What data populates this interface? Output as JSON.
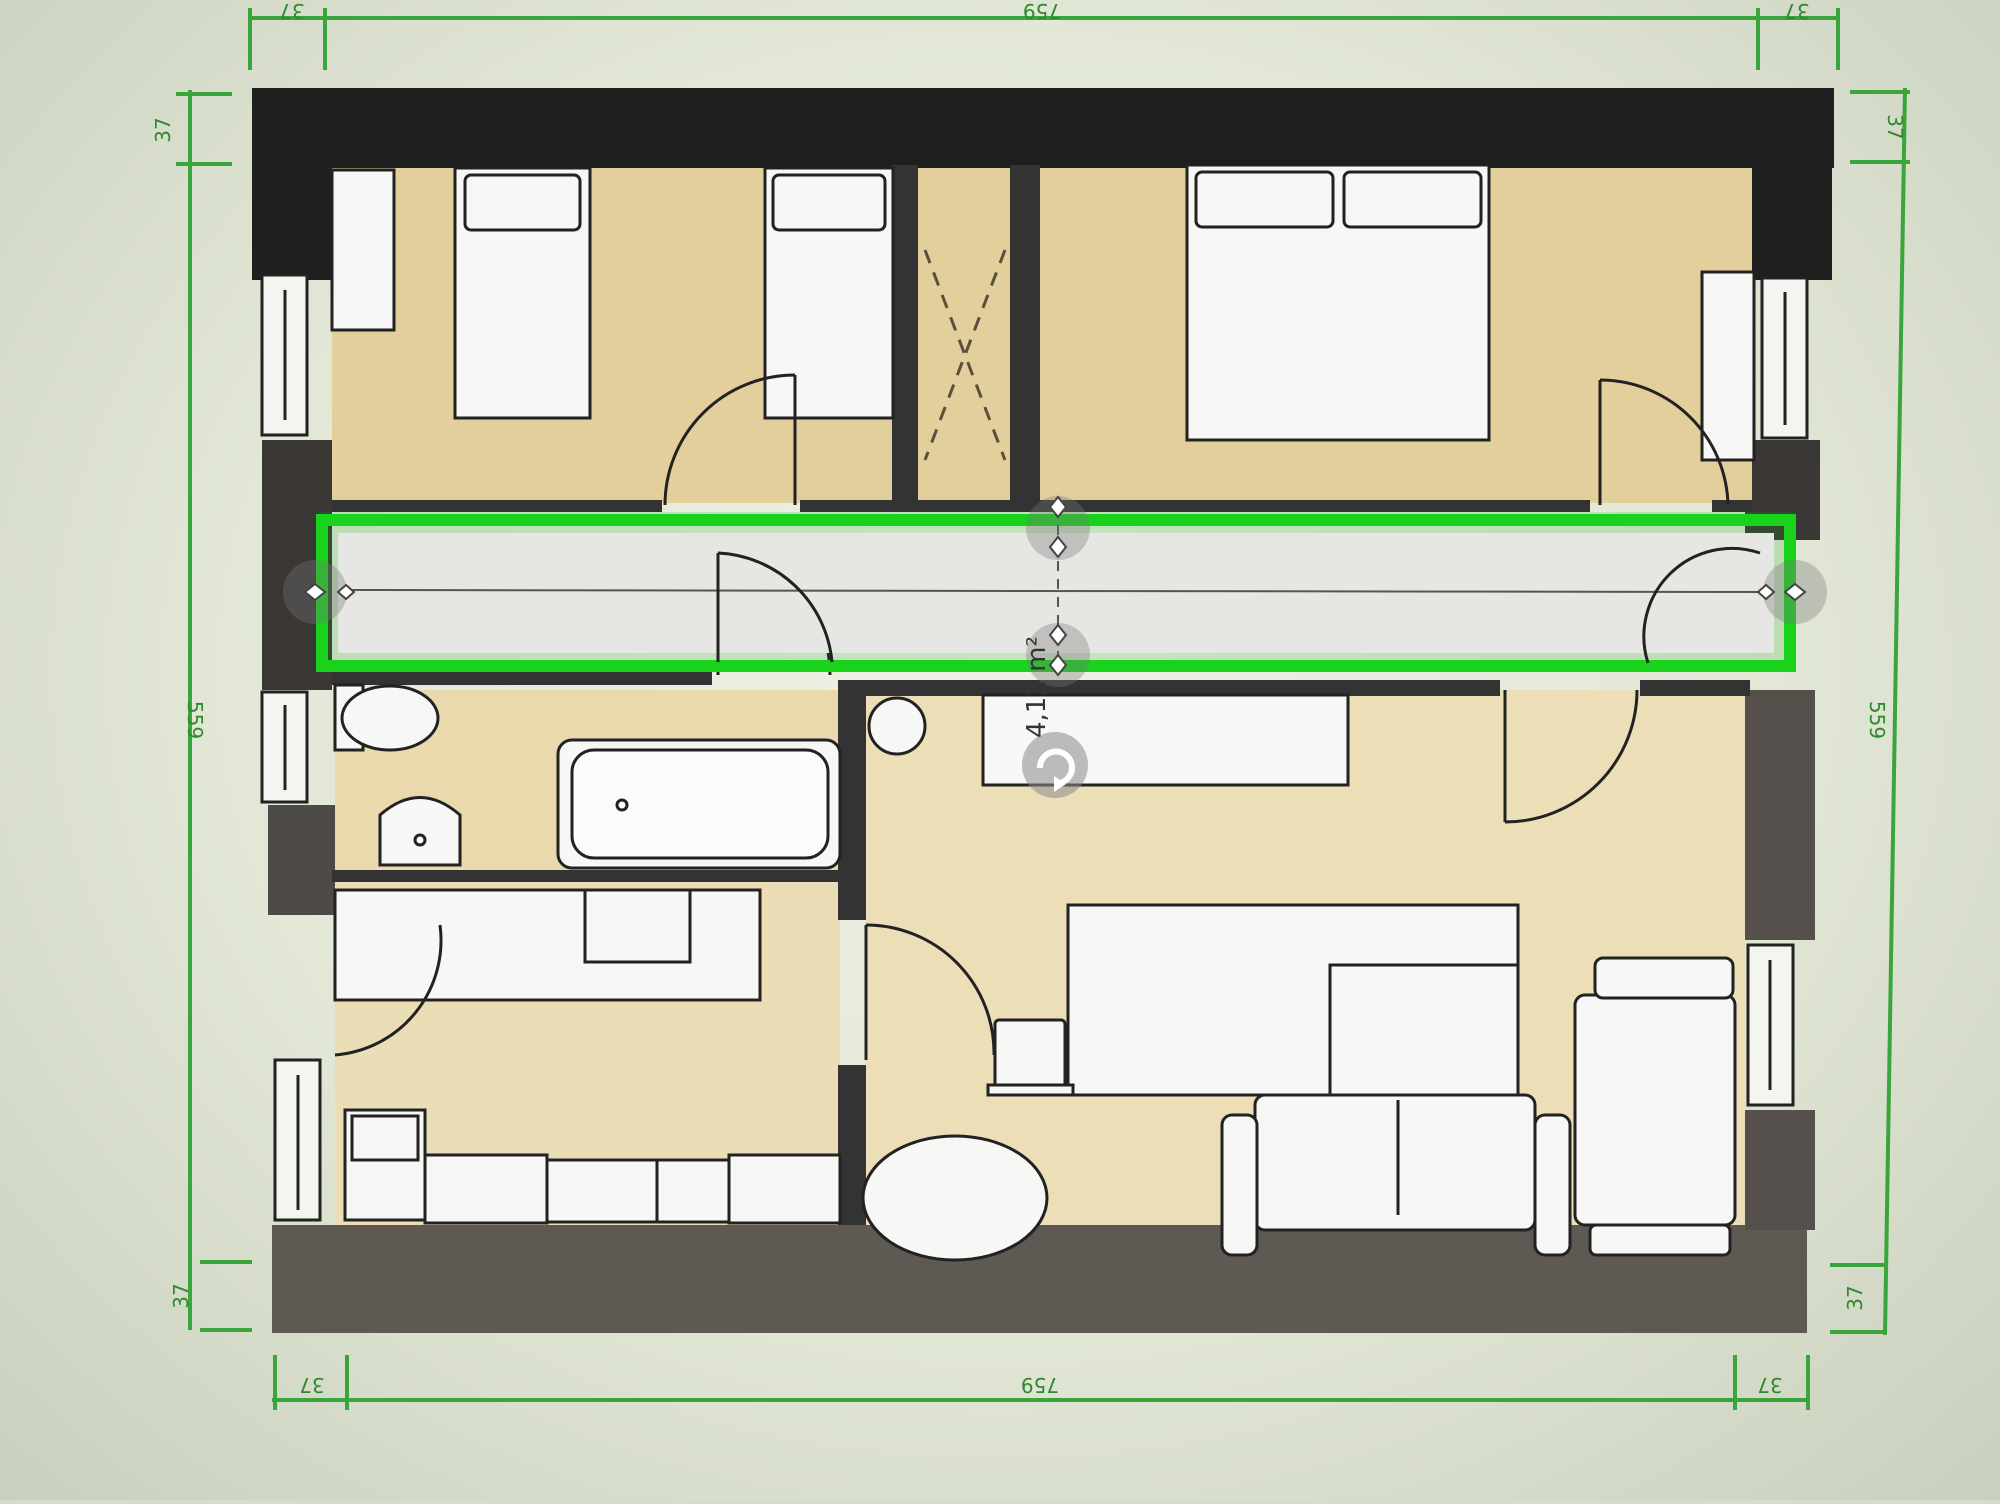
{
  "dimensions": {
    "top_left": "37",
    "top_total": "759",
    "top_right": "37",
    "left_top": "37",
    "left_total": "559",
    "left_bottom": "37",
    "right_top": "37",
    "right_total": "559",
    "right_bottom": "37",
    "bottom_left": "37",
    "bottom_total": "759",
    "bottom_right": "37"
  },
  "selection": {
    "area_label": "4,12 m²"
  },
  "colors": {
    "wall": "#222222",
    "wall_gray": "#5e5953",
    "room_floor": "#e2cf9c",
    "living_floor": "#ecdfb8",
    "selection_green": "#17c41a",
    "dimension_line": "#3aa53a"
  },
  "icons": {
    "rotate_handle": "rotate-icon",
    "move_handle": "diamond-handle-icon"
  }
}
